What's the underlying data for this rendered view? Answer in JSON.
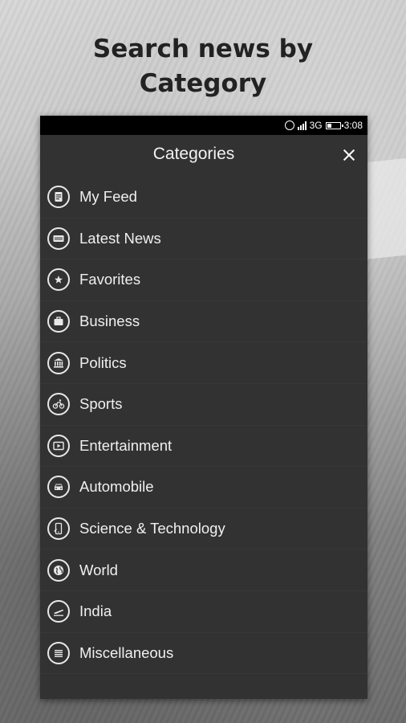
{
  "promo": {
    "headline_line1": "Search news by",
    "headline_line2": "Category"
  },
  "status_bar": {
    "network": "3G",
    "time": "3:08",
    "icons": [
      "alarm-icon",
      "signal-icon",
      "battery-icon"
    ]
  },
  "drawer": {
    "title": "Categories",
    "close_icon": "close-icon"
  },
  "categories": [
    {
      "label": "My Feed",
      "icon": "feed-icon"
    },
    {
      "label": "Latest News",
      "icon": "news-icon"
    },
    {
      "label": "Favorites",
      "icon": "star-icon"
    },
    {
      "label": "Business",
      "icon": "briefcase-icon"
    },
    {
      "label": "Politics",
      "icon": "government-building-icon"
    },
    {
      "label": "Sports",
      "icon": "bicycle-icon"
    },
    {
      "label": "Entertainment",
      "icon": "play-video-icon"
    },
    {
      "label": "Automobile",
      "icon": "car-icon"
    },
    {
      "label": "Science & Technology",
      "icon": "phone-device-icon"
    },
    {
      "label": "World",
      "icon": "globe-icon"
    },
    {
      "label": "India",
      "icon": "airplane-icon"
    },
    {
      "label": "Miscellaneous",
      "icon": "list-lines-icon"
    }
  ],
  "colors": {
    "drawer_bg": "#323232",
    "status_bar_bg": "#000000",
    "text": "#f0f0f0",
    "headline": "#222222"
  }
}
